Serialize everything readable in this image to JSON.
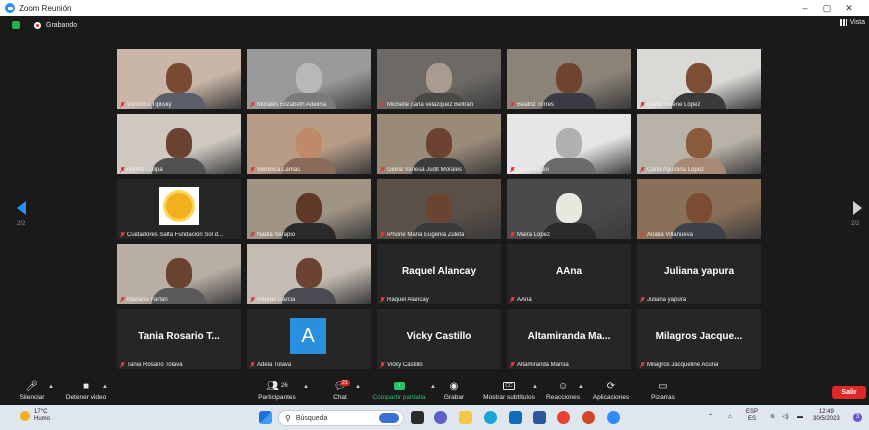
{
  "window": {
    "title": "Zoom Reunión",
    "minimize": "–",
    "maximize": "▢",
    "close": "✕"
  },
  "meeting": {
    "recording_label": "Grabando",
    "view_label": "Vista",
    "page_left": "2/2",
    "page_right": "2/2"
  },
  "participants": [
    {
      "name": "Veronica Tiplisky",
      "type": "video",
      "bg": "#c9b6a8",
      "skin": "#7a4a32",
      "cloth": "#5b5f6a"
    },
    {
      "name": "Morales Elizabeth Adelina",
      "type": "video",
      "bg": "#9a9a9a",
      "skin": "#b8b8b8",
      "cloth": "#7a7a7a"
    },
    {
      "name": "Michelle carla velazquez Beltran",
      "type": "video",
      "bg": "#6d6a66",
      "skin": "#a89c90",
      "cloth": "#4a4844"
    },
    {
      "name": "Beatriz Torres",
      "type": "video",
      "bg": "#8b8378",
      "skin": "#6e4630",
      "cloth": "#3b3b44"
    },
    {
      "name": "Maria Selene López",
      "type": "video",
      "bg": "#d9d9d6",
      "skin": "#7c4e34",
      "cloth": "#3a3a3a"
    },
    {
      "name": "norma Culipa",
      "type": "video",
      "bg": "#cfc9c2",
      "skin": "#6a4230",
      "cloth": "#505050"
    },
    {
      "name": "Veronica Lamas",
      "type": "video",
      "bg": "#b89c86",
      "skin": "#c08a6a",
      "cloth": "#8a6a58"
    },
    {
      "name": "Gloria Vanesa Judit Morales",
      "type": "video",
      "bg": "#9a8a78",
      "skin": "#6b4330",
      "cloth": "#3c3c3c"
    },
    {
      "name": "Eli Quipildor",
      "type": "video",
      "bg": "#e6e6e6",
      "skin": "#b0b0b0",
      "cloth": "#6a6a6a"
    },
    {
      "name": "Carla Agustina Lopez",
      "type": "video",
      "active": true,
      "bg": "#b8b2a8",
      "skin": "#8a5a3c",
      "cloth": "#a88a74"
    },
    {
      "name": "Cuidadores Salta Fundación Sol d...",
      "type": "logo",
      "bg": "#262626"
    },
    {
      "name": "Nadia Serapio",
      "type": "video",
      "bg": "#a09484",
      "skin": "#5e3a26",
      "cloth": "#2a2a2a"
    },
    {
      "name": "iPhone Maria Eugenia Zuleta",
      "type": "video",
      "bg": "#5a5048",
      "skin": "#6a4430",
      "cloth": "#3a3a3a"
    },
    {
      "name": "Maira López",
      "type": "video",
      "bg": "#4a4a4a",
      "skin": "#e8e8e0",
      "cloth": "#2a2a2a"
    },
    {
      "name": "Analia Villanueva",
      "type": "video",
      "bg": "#8a7058",
      "skin": "#7a4c34",
      "cloth": "#3c4048"
    },
    {
      "name": "Mariana Farfan",
      "type": "video",
      "bg": "#b8aea4",
      "skin": "#6a4230",
      "cloth": "#5a5a5a"
    },
    {
      "name": "Raquel Garcia",
      "type": "video",
      "bg": "#c4bcb2",
      "skin": "#6b4330",
      "cloth": "#4a4a52"
    },
    {
      "name": "Raquel Alancay",
      "type": "name",
      "display": "Raquel Alancay"
    },
    {
      "name": "AAna",
      "type": "name",
      "display": "AAna"
    },
    {
      "name": "Juliana yapura",
      "type": "name",
      "display": "Juliana yapura"
    },
    {
      "name": "Tania Rosario Tolava",
      "type": "name",
      "display": "Tania Rosario T..."
    },
    {
      "name": "Adela Tolava",
      "type": "avatar",
      "display": "A"
    },
    {
      "name": "Vicky Castillo",
      "type": "name",
      "display": "Vicky Castillo"
    },
    {
      "name": "Altamiranda Marcia",
      "type": "name",
      "display": "Altamiranda Ma..."
    },
    {
      "name": "Milagros Jacqueline Acuña",
      "type": "name",
      "display": "Milagros Jacque..."
    }
  ],
  "toolbar": {
    "mute": "Silenciar",
    "stop_video": "Detener video",
    "participants": "Participantes",
    "participants_count": "26",
    "chat": "Chat",
    "chat_badge": "21",
    "share": "Compartir pantalla",
    "record": "Grabar",
    "captions": "Mostrar subtítulos",
    "captions_icon": "CC",
    "reactions": "Reacciones",
    "apps": "Aplicaciones",
    "whiteboards": "Pizarras",
    "leave": "Salir"
  },
  "taskbar": {
    "temp": "17°C",
    "weather": "Humo",
    "search_placeholder": "Búsqueda",
    "lang": "ESP",
    "lang_sub": "ES",
    "time": "12:49",
    "date": "30/5/2023",
    "notif_count": "3"
  },
  "colors": {
    "accent": "#2d8cff",
    "active_speaker": "#c8d93c",
    "leave": "#e02828",
    "share": "#25c26e"
  }
}
